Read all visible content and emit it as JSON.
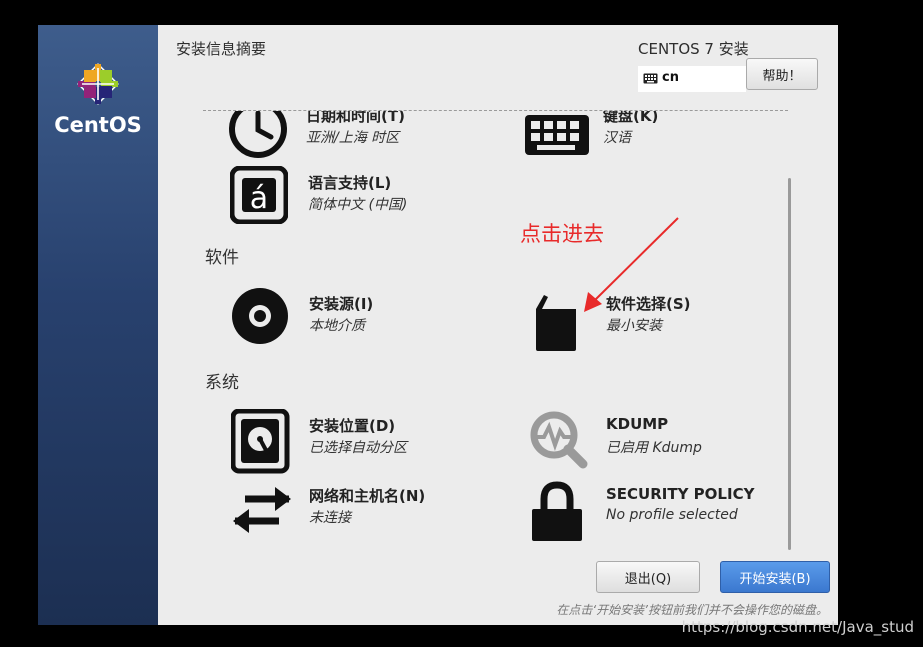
{
  "sidebar": {
    "brand": "CentOS"
  },
  "header": {
    "title": "安装信息摘要",
    "version": "CENTOS 7 安装",
    "keyboard_layout": "cn",
    "help_label": "帮助！"
  },
  "sections": {
    "software": "软件",
    "system": "系统"
  },
  "spokes": {
    "datetime": {
      "title": "日期和时间(T)",
      "status": "亚洲/上海 时区"
    },
    "keyboard": {
      "title": "键盘(K)",
      "status": "汉语"
    },
    "language": {
      "title": "语言支持(L)",
      "status": "简体中文 (中国)"
    },
    "source": {
      "title": "安装源(I)",
      "status": "本地介质"
    },
    "software_selection": {
      "title": "软件选择(S)",
      "status": "最小安装"
    },
    "destination": {
      "title": "安装位置(D)",
      "status": "已选择自动分区"
    },
    "kdump": {
      "title": "KDUMP",
      "status": "已启用 Kdump"
    },
    "network": {
      "title": "网络和主机名(N)",
      "status": "未连接"
    },
    "security": {
      "title": "SECURITY POLICY",
      "status": "No profile selected"
    }
  },
  "annotation": {
    "text": "点击进去",
    "color": "#e82a2a"
  },
  "footer": {
    "quit_label": "退出(Q)",
    "begin_label": "开始安装(B)",
    "note": "在点击‘开始安装’按钮前我们并不会操作您的磁盘。"
  },
  "watermark": "https://blog.csdn.net/Java_stud",
  "colors": {
    "sidebar": "#28416e",
    "primary_button": "#3b78cf",
    "annotation": "#e82a2a"
  }
}
